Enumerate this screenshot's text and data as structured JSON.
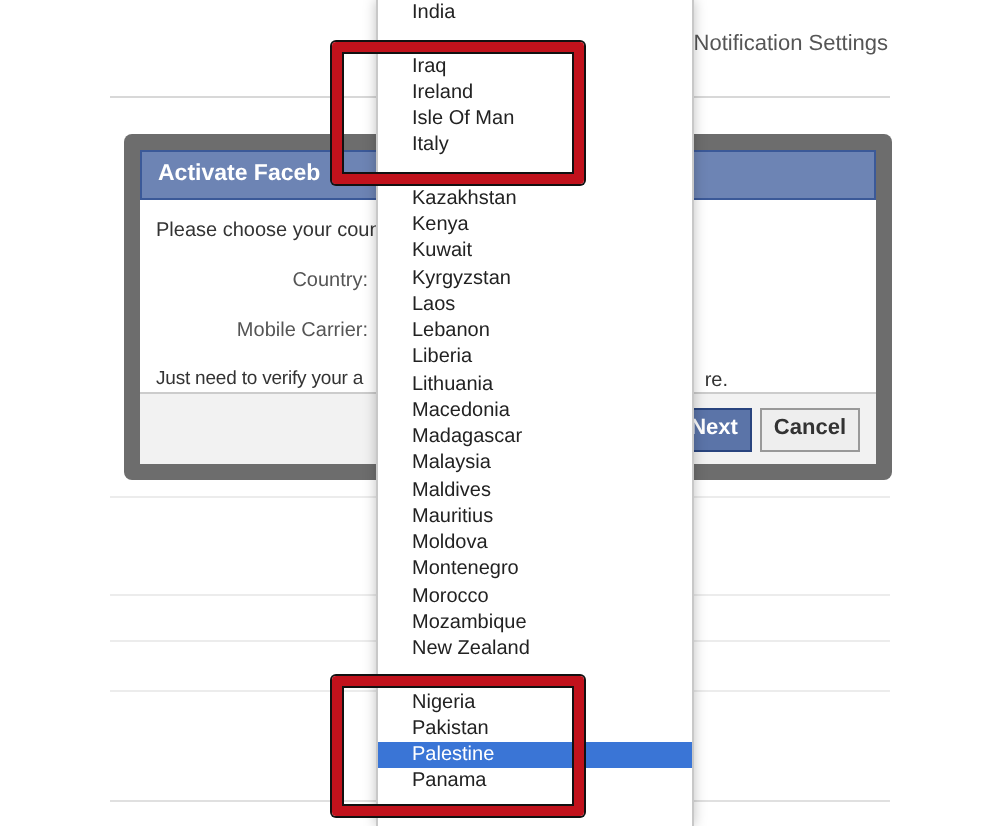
{
  "header": {
    "link": "Notification Settings"
  },
  "dialog": {
    "title": "Activate Faceb",
    "prompt": "Please choose your coun",
    "fields": [
      {
        "label": "Country:"
      },
      {
        "label": "Mobile Carrier:"
      }
    ],
    "note": "Just need to verify your a",
    "note_end": "re.",
    "buttons": [
      {
        "label": "Next",
        "kind": "primary"
      },
      {
        "label": "Cancel",
        "kind": "secondary"
      }
    ]
  },
  "dropdown": {
    "groups": [
      [
        {
          "label": "India",
          "selected": false
        }
      ],
      [
        {
          "label": "Iraq",
          "selected": false
        },
        {
          "label": "Ireland",
          "selected": false
        },
        {
          "label": "Isle Of Man",
          "selected": false
        },
        {
          "label": "Italy",
          "selected": false
        }
      ],
      [
        {
          "label": "Kazakhstan",
          "selected": false
        },
        {
          "label": "Kenya",
          "selected": false
        },
        {
          "label": "Kuwait",
          "selected": false
        },
        {
          "label": "Kyrgyzstan",
          "selected": false
        },
        {
          "label": "Laos",
          "selected": false
        },
        {
          "label": "Lebanon",
          "selected": false
        },
        {
          "label": "Liberia",
          "selected": false
        },
        {
          "label": "Lithuania",
          "selected": false
        },
        {
          "label": "Macedonia",
          "selected": false
        },
        {
          "label": "Madagascar",
          "selected": false
        },
        {
          "label": "Malaysia",
          "selected": false
        },
        {
          "label": "Maldives",
          "selected": false
        },
        {
          "label": "Mauritius",
          "selected": false
        },
        {
          "label": "Moldova",
          "selected": false
        },
        {
          "label": "Montenegro",
          "selected": false
        },
        {
          "label": "Morocco",
          "selected": false
        },
        {
          "label": "Mozambique",
          "selected": false
        },
        {
          "label": "New Zealand",
          "selected": false
        }
      ],
      [
        {
          "label": "Nigeria",
          "selected": false
        },
        {
          "label": "Pakistan",
          "selected": false
        },
        {
          "label": "Palestine",
          "selected": true
        },
        {
          "label": "Panama",
          "selected": false
        }
      ]
    ]
  }
}
